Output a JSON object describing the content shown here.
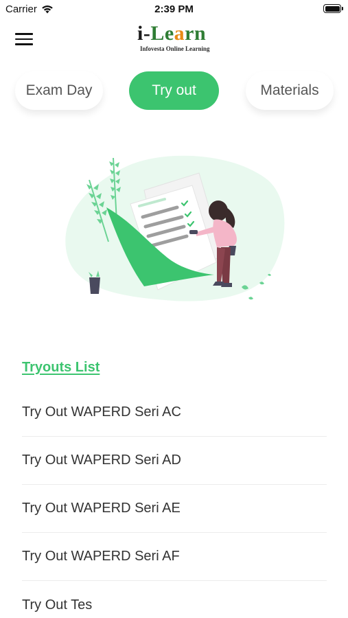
{
  "status_bar": {
    "carrier": "Carrier",
    "time": "2:39 PM"
  },
  "header": {
    "logo_i": "i",
    "logo_dash": "-",
    "logo_le": "Le",
    "logo_a": "a",
    "logo_rn": "rn",
    "logo_subtitle": "Infovesta Online Learning",
    "menu_icon": "hamburger-menu-icon"
  },
  "tabs": [
    {
      "label": "Exam Day",
      "selected": false
    },
    {
      "label": "Try out",
      "selected": true
    },
    {
      "label": "Materials",
      "selected": false
    }
  ],
  "colors": {
    "accent": "#3cc46f",
    "logo_green": "#2f7d34",
    "logo_orange": "#e98a16"
  },
  "list": {
    "title": "Tryouts List",
    "items": [
      "Try Out WAPERD Seri AC",
      "Try Out WAPERD Seri AD",
      "Try Out WAPERD Seri AE",
      "Try Out WAPERD Seri AF",
      "Try Out Tes"
    ]
  }
}
